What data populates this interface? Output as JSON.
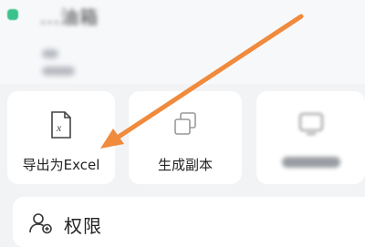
{
  "header": {
    "title": "...油箱",
    "subtitle": ""
  },
  "actions": [
    {
      "label": "导出为Excel",
      "icon": "excel-file-icon"
    },
    {
      "label": "生成副本",
      "icon": "copy-icon"
    },
    {
      "label": "",
      "icon": "display-icon"
    }
  ],
  "permission": {
    "label": "权限",
    "icon": "user-permission-icon"
  },
  "colors": {
    "accent": "#f08a3c",
    "tile": "#ffffff",
    "background": "#f2f3f5"
  }
}
